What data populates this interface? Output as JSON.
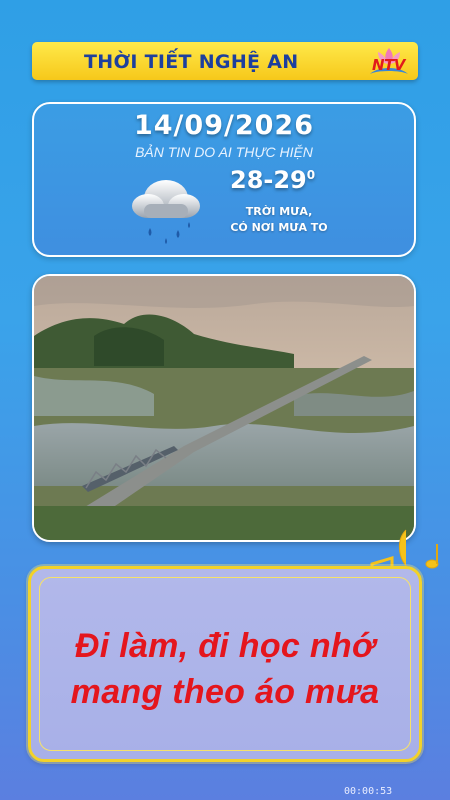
{
  "header": {
    "title": "THỜI TIẾT NGHỆ AN",
    "logo_text": "NTV"
  },
  "weather": {
    "date": "14/09/2026",
    "subtitle": "BẢN TIN DO AI THỰC HIỆN",
    "temperature": "28-29",
    "degree_symbol": "0",
    "condition_line1": "TRỜI MƯA,",
    "condition_line2": "CÓ NƠI MƯA TO",
    "icon": "rain-cloud-icon"
  },
  "message": {
    "line1": "Đi làm, đi học nhớ",
    "line2": "mang theo áo mưa"
  },
  "timer": "00:00:53",
  "colors": {
    "header_bg": "#f6c81a",
    "header_text": "#1d3f9e",
    "message_text": "#e4161d",
    "frame_gold": "#f2d22a"
  }
}
